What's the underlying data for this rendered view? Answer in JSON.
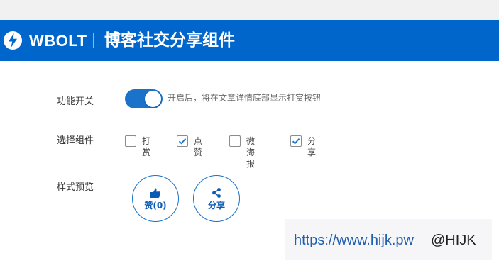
{
  "header": {
    "logo_icon": "lightning-bolt-icon",
    "logo_text": "WBOLT",
    "title": "博客社交分享组件"
  },
  "colors": {
    "brand_blue": "#0066cc",
    "toggle_on": "#1a73c9",
    "checkbox_check": "#1a73c9"
  },
  "settings": {
    "feature_switch": {
      "label": "功能开关",
      "enabled": true,
      "description": "开启后，将在文章详情底部显示打赏按钮"
    },
    "components": {
      "label": "选择组件",
      "options": [
        {
          "label": "打赏",
          "checked": false
        },
        {
          "label": "点赞",
          "checked": true
        },
        {
          "label": "微海报",
          "checked": false
        },
        {
          "label": "分享",
          "checked": true
        }
      ]
    },
    "preview": {
      "label": "样式预览",
      "buttons": [
        {
          "label": "赞(0)",
          "icon": "thumbs-up-icon"
        },
        {
          "label": "分享",
          "icon": "share-icon"
        }
      ]
    }
  },
  "watermark": {
    "url": "https://www.hijk.pw",
    "handle": "@HIJK"
  }
}
